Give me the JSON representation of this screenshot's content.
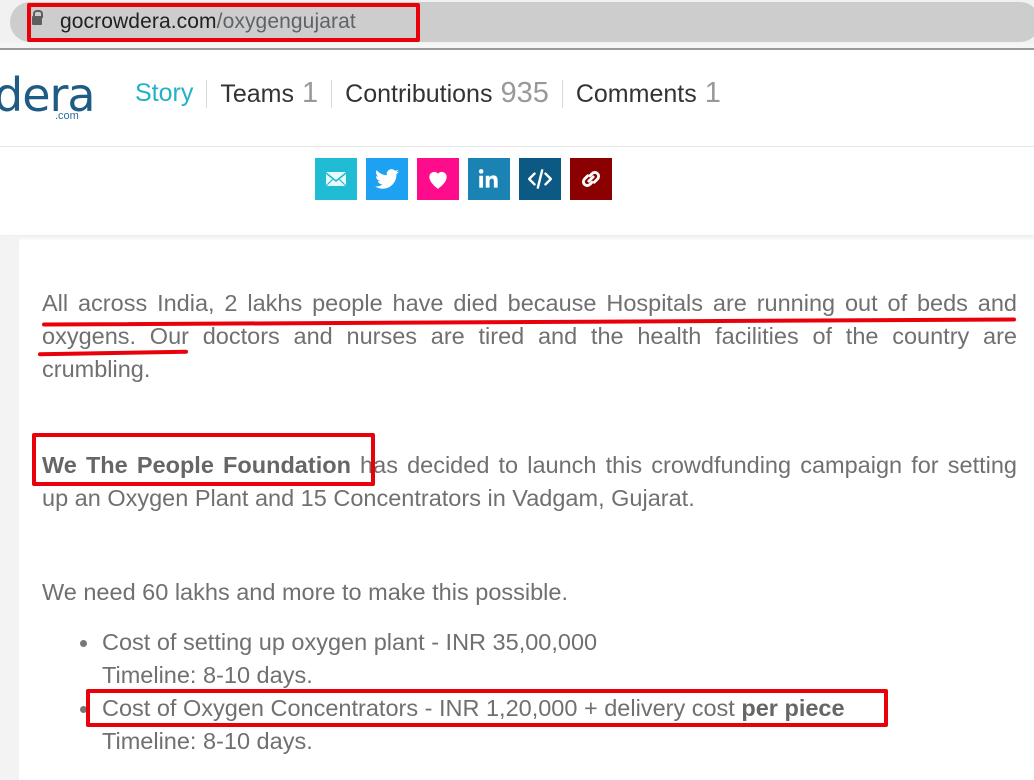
{
  "browser": {
    "url_host": "gocrowdera.com",
    "url_path": "/oxygengujarat",
    "lock_icon": "lock-icon"
  },
  "header": {
    "logo_text": "dera",
    "logo_suffix": ".com",
    "nav": [
      {
        "label": "Story",
        "count": "",
        "active": true
      },
      {
        "label": "Teams",
        "count": "1"
      },
      {
        "label": "Contributions",
        "count": "935"
      },
      {
        "label": "Comments",
        "count": "1"
      }
    ]
  },
  "share": {
    "buttons": [
      {
        "name": "email",
        "icon": "envelope-icon",
        "color": "#20bcd4"
      },
      {
        "name": "twitter",
        "icon": "twitter-bird-icon",
        "color": "#1da1f2"
      },
      {
        "name": "favorite",
        "icon": "heart-icon",
        "color": "#ff0c8c"
      },
      {
        "name": "linkedin",
        "icon": "linkedin-icon",
        "color": "#1b83b4"
      },
      {
        "name": "embed",
        "icon": "code-icon",
        "color": "#0c5a84"
      },
      {
        "name": "copy-link",
        "icon": "link-icon",
        "color": "#8b0000"
      }
    ]
  },
  "story": {
    "paragraph1": "All across India, 2 lakhs people have died because Hospitals are running out of beds and oxygens. Our doctors and nurses are tired and the health facilities of the country are crumbling.",
    "paragraph2_bold": "We The People Foundation",
    "paragraph2_rest": " has decided to launch this crowdfunding campaign for setting up an Oxygen Plant and 15 Concentrators in Vadgam, Gujarat.",
    "paragraph3": "We need 60 lakhs and more to make this possible.",
    "costs": [
      {
        "line1": "Cost of setting up oxygen plant - INR 35,00,000",
        "line1_bold": "",
        "line2": "Timeline: 8-10 days."
      },
      {
        "line1": "Cost of Oxygen Concentrators - INR 1,20,000 + delivery cost ",
        "line1_bold": "per piece",
        "line2": "Timeline: 8-10 days."
      }
    ]
  },
  "annotations": {
    "color": "#e8000b"
  }
}
